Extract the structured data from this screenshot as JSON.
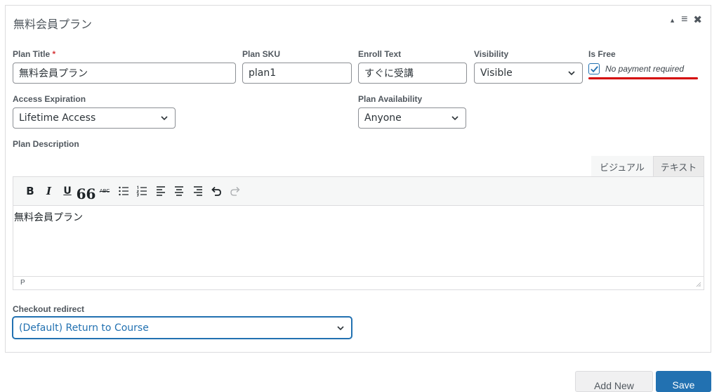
{
  "panel": {
    "title": "無料会員プラン",
    "controls": {
      "collapse_icon": "triangle-up-icon",
      "menu_icon": "hamburger-icon",
      "close_icon": "close-icon"
    }
  },
  "fields": {
    "plan_title": {
      "label": "Plan Title",
      "required_mark": "*",
      "value": "無料会員プラン"
    },
    "plan_sku": {
      "label": "Plan SKU",
      "value": "plan1"
    },
    "enroll_text": {
      "label": "Enroll Text",
      "value": "すぐに受講"
    },
    "visibility": {
      "label": "Visibility",
      "value": "Visible"
    },
    "is_free": {
      "label": "Is Free",
      "checked": true,
      "checkbox_label": "No payment required"
    },
    "access_expiration": {
      "label": "Access Expiration",
      "value": "Lifetime Access"
    },
    "plan_availability": {
      "label": "Plan Availability",
      "value": "Anyone"
    },
    "plan_description": {
      "label": "Plan Description"
    },
    "checkout_redirect": {
      "label": "Checkout redirect",
      "value": "(Default) Return to Course"
    }
  },
  "editor": {
    "tabs": {
      "visual": "ビジュアル",
      "text": "テキスト"
    },
    "toolbar": {
      "bold": "B",
      "italic": "I",
      "underline": "U",
      "blockquote": "66",
      "strikethrough": "ABC"
    },
    "content": "無料会員プラン",
    "status_path": "P"
  },
  "footer": {
    "add_new_label": "Add New",
    "save_label": "Save"
  },
  "colors": {
    "accent": "#2271b1",
    "annotation_underline": "#d40000",
    "required": "#d63638"
  }
}
